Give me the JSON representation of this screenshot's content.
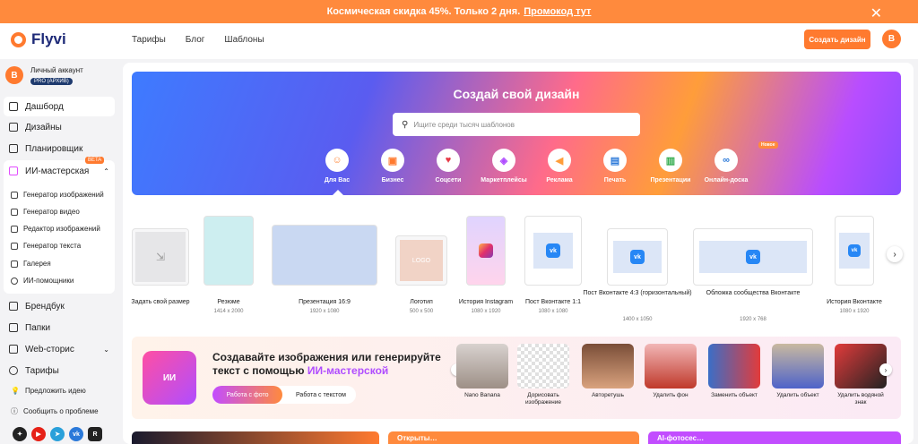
{
  "promo": {
    "text": "Космическая скидка 45%. Только 2 дня.",
    "link": "Промокод тут",
    "close": "✕"
  },
  "header": {
    "logo": "Flyvi",
    "nav": [
      "Тарифы",
      "Блог",
      "Шаблоны"
    ],
    "cta": "Создать дизайн",
    "avatar": "B"
  },
  "sidebar": {
    "account": {
      "avatar": "B",
      "name": "Личный аккаунт",
      "plan": "PRO (АРХИВ)"
    },
    "items": [
      {
        "label": "Дашборд",
        "icon": "grid-icon"
      },
      {
        "label": "Дизайны",
        "icon": "designs-icon"
      },
      {
        "label": "Планировщик",
        "icon": "calendar-icon"
      },
      {
        "label": "ИИ-мастерская",
        "icon": "ai-icon"
      }
    ],
    "beta": "BETA",
    "ai_sub": [
      "Генератор изображений",
      "Генератор видео",
      "Редактор изображений",
      "Генератор текста",
      "Галерея",
      "ИИ-помощники"
    ],
    "items2": [
      {
        "label": "Брендбук",
        "icon": "brandbook-icon"
      },
      {
        "label": "Папки",
        "icon": "folder-icon"
      },
      {
        "label": "Web-сторис",
        "icon": "stories-icon"
      },
      {
        "label": "Тарифы",
        "icon": "tariff-icon"
      }
    ],
    "small": [
      "Предложить идею",
      "Сообщить о проблеме"
    ]
  },
  "hero": {
    "title": "Создай свой дизайн",
    "search_placeholder": "Ищите среди тысяч шаблонов",
    "categories": [
      "Для Вас",
      "Бизнес",
      "Соцсети",
      "Маркетплейсы",
      "Реклама",
      "Печать",
      "Презентации",
      "Онлайн-доска"
    ],
    "new_badge": "Новое"
  },
  "templates": [
    {
      "label": "Задать свой размер",
      "size": ""
    },
    {
      "label": "Резюме",
      "size": "1414 x 2000"
    },
    {
      "label": "Презентация 16:9",
      "size": "1920 x 1080"
    },
    {
      "label": "Логотип",
      "size": "500 x 500"
    },
    {
      "label": "История Instagram",
      "size": "1080 x 1920"
    },
    {
      "label": "Пост Вконтакте 1:1",
      "size": "1080 x 1080"
    },
    {
      "label": "Пост Вконтакте 4:3 (горизонтальный)",
      "size": "1400 x 1050"
    },
    {
      "label": "Обложка сообщества Вконтакте",
      "size": "1920 x 768"
    },
    {
      "label": "История Вконтакте",
      "size": "1080 x 1920"
    }
  ],
  "logo_placeholder": "LOGO",
  "ai_banner": {
    "title": "Создавайте изображения или генерируйте текст с помощью",
    "title_hl": "ИИ-мастерской",
    "logo": "ИИ",
    "tab_on": "Работа с фото",
    "tab_off": "Работа с текстом",
    "cards": [
      "Nano Banana",
      "Дорисовать изображение",
      "Авторетушь",
      "Удалить фон",
      "Заменить объект",
      "Удалить объект",
      "Удалить водяной знак"
    ]
  },
  "bottom": {
    "c2": "Открыты…",
    "c4": "AI-фотосес…"
  }
}
